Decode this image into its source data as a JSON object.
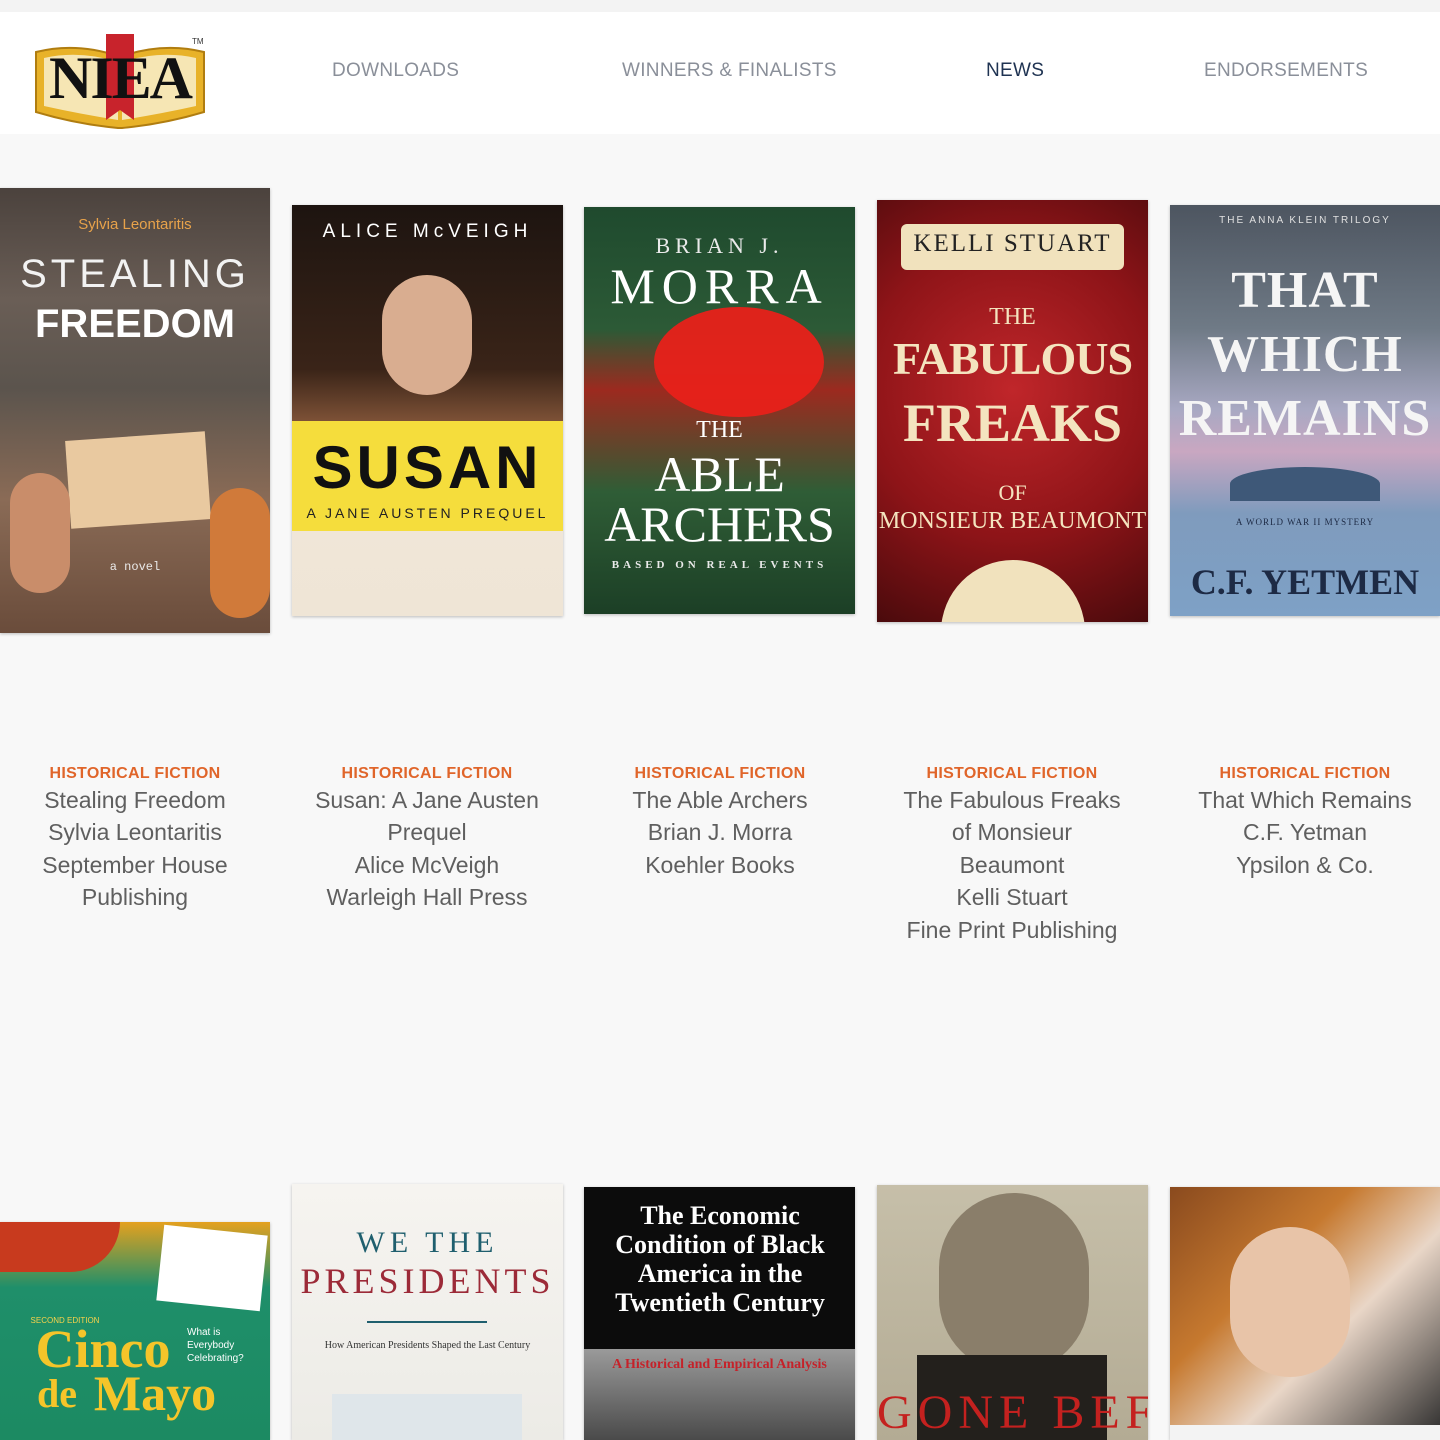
{
  "site": {
    "logo_text": "NIEA",
    "logo_tm": "TM"
  },
  "nav": {
    "items": [
      {
        "label": "DOWNLOADS",
        "active": false
      },
      {
        "label": "WINNERS & FINALISTS",
        "active": false
      },
      {
        "label": "NEWS",
        "active": true
      },
      {
        "label": "ENDORSEMENTS",
        "active": false
      }
    ]
  },
  "books": [
    {
      "genre": "HISTORICAL FICTION",
      "lines": [
        "Stealing Freedom",
        "Sylvia Leontaritis",
        "September House",
        "Publishing"
      ],
      "cover": {
        "author": "Sylvia Leontaritis",
        "title_1": "STEALING",
        "title_2": "FREEDOM",
        "tag": "a novel"
      }
    },
    {
      "genre": "HISTORICAL FICTION",
      "lines": [
        "Susan: A Jane Austen",
        "Prequel",
        "Alice McVeigh",
        "Warleigh Hall Press"
      ],
      "cover": {
        "author": "ALICE McVEIGH",
        "title": "SUSAN",
        "subtitle": "A JANE AUSTEN PREQUEL"
      }
    },
    {
      "genre": "HISTORICAL FICTION",
      "lines": [
        "The Able Archers",
        "Brian J. Morra",
        "Koehler Books"
      ],
      "cover": {
        "author_1": "BRIAN J.",
        "author_2": "MORRA",
        "title_1": "THE",
        "title_2": "ABLE",
        "title_3": "ARCHERS",
        "tag": "BASED ON REAL EVENTS"
      }
    },
    {
      "genre": "HISTORICAL FICTION",
      "lines": [
        "The Fabulous Freaks",
        "of Monsieur",
        "Beaumont",
        "Kelli Stuart",
        "Fine Print Publishing"
      ],
      "cover": {
        "author": "KELLI STUART",
        "title_1": "THE",
        "title_2": "FABULOUS",
        "title_3": "FREAKS",
        "title_4": "OF",
        "title_5": "MONSIEUR BEAUMONT"
      }
    },
    {
      "genre": "HISTORICAL FICTION",
      "lines": [
        "That Which Remains",
        "C.F. Yetman",
        "Ypsilon & Co."
      ],
      "cover": {
        "series": "THE ANNA KLEIN TRILOGY",
        "title_1": "THAT",
        "title_2": "WHICH",
        "title_3": "REMAINS",
        "tag": "A WORLD WAR II MYSTERY",
        "author": "C.F. YETMEN"
      }
    }
  ],
  "row2_covers": [
    {
      "edition": "SECOND EDITION",
      "title_1": "Cinco",
      "title_2": "de",
      "title_3": "Mayo",
      "aside": "What is Everybody Celebrating?"
    },
    {
      "title_1": "WE THE",
      "title_2": "PRESIDENTS",
      "subtitle": "How American Presidents Shaped the Last Century"
    },
    {
      "title": "The Economic Condition of Black America in the Twentieth Century",
      "subtitle": "A Historical and Empirical Analysis"
    },
    {
      "title": "GONE BEFORE"
    },
    {}
  ],
  "colors": {
    "nav_active": "#1f3352",
    "nav_inactive": "#8a8f99",
    "genre": "#e0652a",
    "body_text": "#5f5f5f"
  }
}
